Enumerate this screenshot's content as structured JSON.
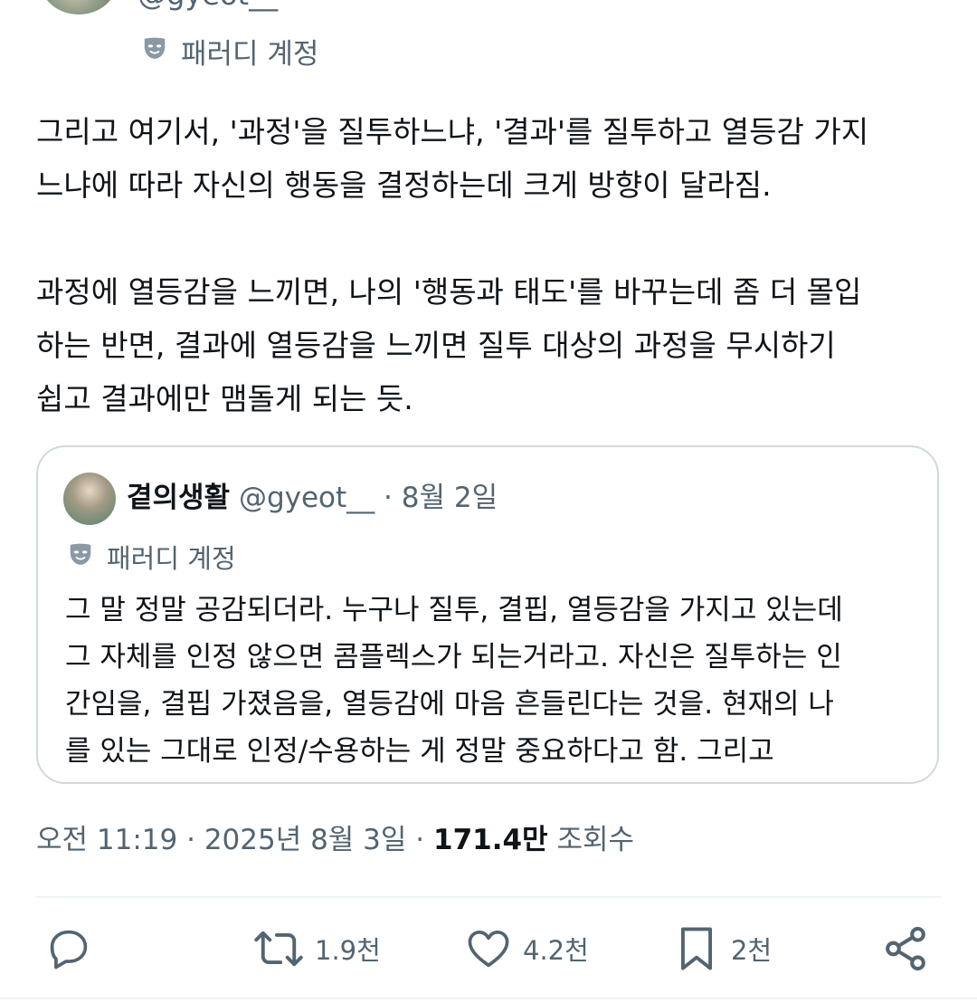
{
  "author": {
    "handle": "@gyeot__",
    "parody_label": "패러디 계정"
  },
  "tweet": {
    "text": "그리고 여기서, '과정'을 질투하느냐, '결과'를 질투하고 열등감 가지\n느냐에 따라 자신의 행동을 결정하는데 크게 방향이 달라짐.\n\n과정에 열등감을 느끼면, 나의 '행동과 태도'를 바꾸는데 좀 더 몰입\n하는 반면, 결과에 열등감을 느끼면 질투 대상의 과정을 무시하기\n쉽고 결과에만 맴돌게 되는 듯."
  },
  "quote": {
    "name": "곁의생활",
    "handle": "@gyeot__",
    "separator": "·",
    "date": "8월 2일",
    "parody_label": "패러디 계정",
    "text": "그 말 정말 공감되더라. 누구나 질투, 결핍, 열등감을 가지고 있는데\n그 자체를 인정 않으면 콤플렉스가 되는거라고. 자신은 질투하는 인\n간임을, 결핍 가졌음을, 열등감에 마음 흔들린다는 것을. 현재의 나\n를 있는 그대로 인정/수용하는 게 정말 중요하다고 함. 그리고"
  },
  "meta": {
    "time": "오전 11:19",
    "sep1": "·",
    "date": "2025년 8월 3일",
    "sep2": "·",
    "views_count": "171.4만",
    "views_label": "조회수"
  },
  "actions": {
    "reply_icon": "reply-icon",
    "retweet_icon": "retweet-icon",
    "retweet_count": "1.9천",
    "like_icon": "heart-icon",
    "like_count": "4.2천",
    "bookmark_icon": "bookmark-icon",
    "bookmark_count": "2천",
    "share_icon": "share-icon"
  },
  "colors": {
    "text_primary": "#0f1419",
    "text_secondary": "#536471",
    "border": "#cfd9de",
    "divider": "#eff3f4"
  }
}
